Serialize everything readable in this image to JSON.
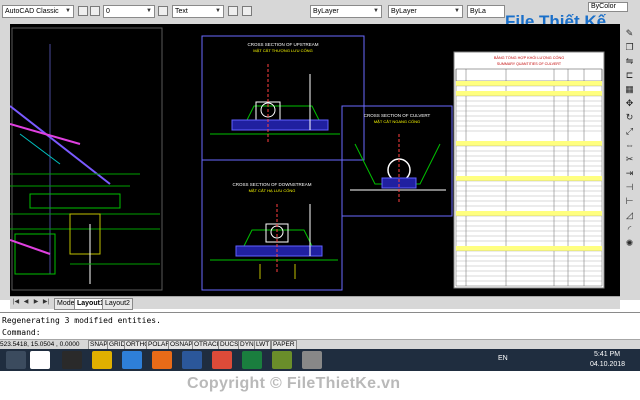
{
  "toolbar": {
    "workspace": "AutoCAD Classic",
    "layer": "0",
    "text_style": "Text",
    "color": "ByLayer",
    "linetype": "ByLayer",
    "lineweight": "ByLa",
    "plot_style": "ByColor"
  },
  "brand_watermark": "File Thiết Kế",
  "drawing": {
    "upstream_title": "CROSS SECTION OF UPSTREAM",
    "upstream_subtitle": "MẶT CẮT THƯỢNG LƯU CỐNG",
    "culvert_title": "CROSS SECTION OF CULVERT",
    "culvert_subtitle": "MẶT CẮT NGANG CỐNG",
    "downstream_title": "CROSS SECTION OF DOWNSTREAM",
    "downstream_subtitle": "MẶT CẮT HẠ LƯU CỐNG",
    "table_title": "BẢNG TỔNG HỢP KHỐI LƯỢNG CỐNG",
    "table_subtitle": "SUMMARY QUANTITIES OF CULVERT"
  },
  "layout_tabs": [
    "Model",
    "Layout1",
    "Layout2"
  ],
  "active_tab": "Layout1",
  "command": {
    "history": "Regenerating 3 modified entities.",
    "prompt": "Command:"
  },
  "status": {
    "coords": "523.5418, 15.0504 , 0.0000",
    "buttons": [
      "SNAP",
      "GRID",
      "ORTHO",
      "POLAR",
      "OSNAP",
      "OTRACK",
      "DUCS",
      "DYN",
      "LWT",
      "PAPER"
    ]
  },
  "taskbar": {
    "language": "EN",
    "time": "5:41 PM",
    "date": "04.10.2018"
  },
  "footer": {
    "copyright": "Copyright © FileThietKe.vn"
  },
  "colors": {
    "canvas": "#000000",
    "chrome": "#d7d7d7",
    "taskbar": "#1f2d3f",
    "logo": "#1a6fc9"
  }
}
